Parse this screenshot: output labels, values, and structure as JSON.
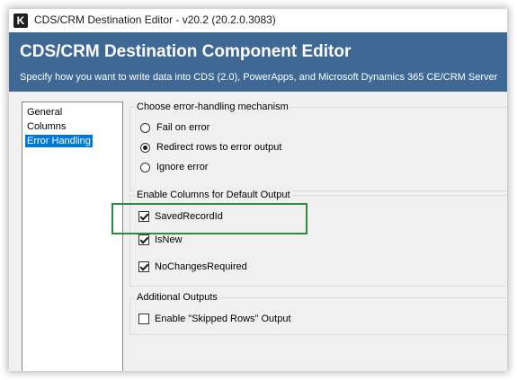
{
  "window": {
    "app_icon_letter": "K",
    "title": "CDS/CRM Destination Editor - v20.2 (20.2.0.3083)"
  },
  "header": {
    "title": "CDS/CRM Destination Component Editor",
    "subtitle": "Specify how you want to write data into CDS (2.0), PowerApps, and Microsoft Dynamics 365 CE/CRM Server"
  },
  "nav": {
    "items": [
      {
        "label": "General"
      },
      {
        "label": "Columns"
      },
      {
        "label": "Error Handling",
        "selected": true
      }
    ]
  },
  "error_handling": {
    "legend": "Choose error-handling mechanism",
    "options": [
      {
        "label": "Fail on error",
        "selected": false
      },
      {
        "label": "Redirect rows to error output",
        "selected": true
      },
      {
        "label": "Ignore error",
        "selected": false
      }
    ]
  },
  "default_output": {
    "legend": "Enable Columns for Default Output",
    "columns": [
      {
        "label": "SavedRecordId",
        "checked": true
      },
      {
        "label": "IsNew",
        "checked": true
      },
      {
        "label": "NoChangesRequired",
        "checked": true
      }
    ]
  },
  "additional_outputs": {
    "legend": "Additional Outputs",
    "options": [
      {
        "label": "Enable \"Skipped Rows\" Output",
        "checked": false
      }
    ]
  },
  "colors": {
    "header_bg": "#3f6895",
    "selection": "#0078d7",
    "highlight_border": "#2e8b3a"
  }
}
